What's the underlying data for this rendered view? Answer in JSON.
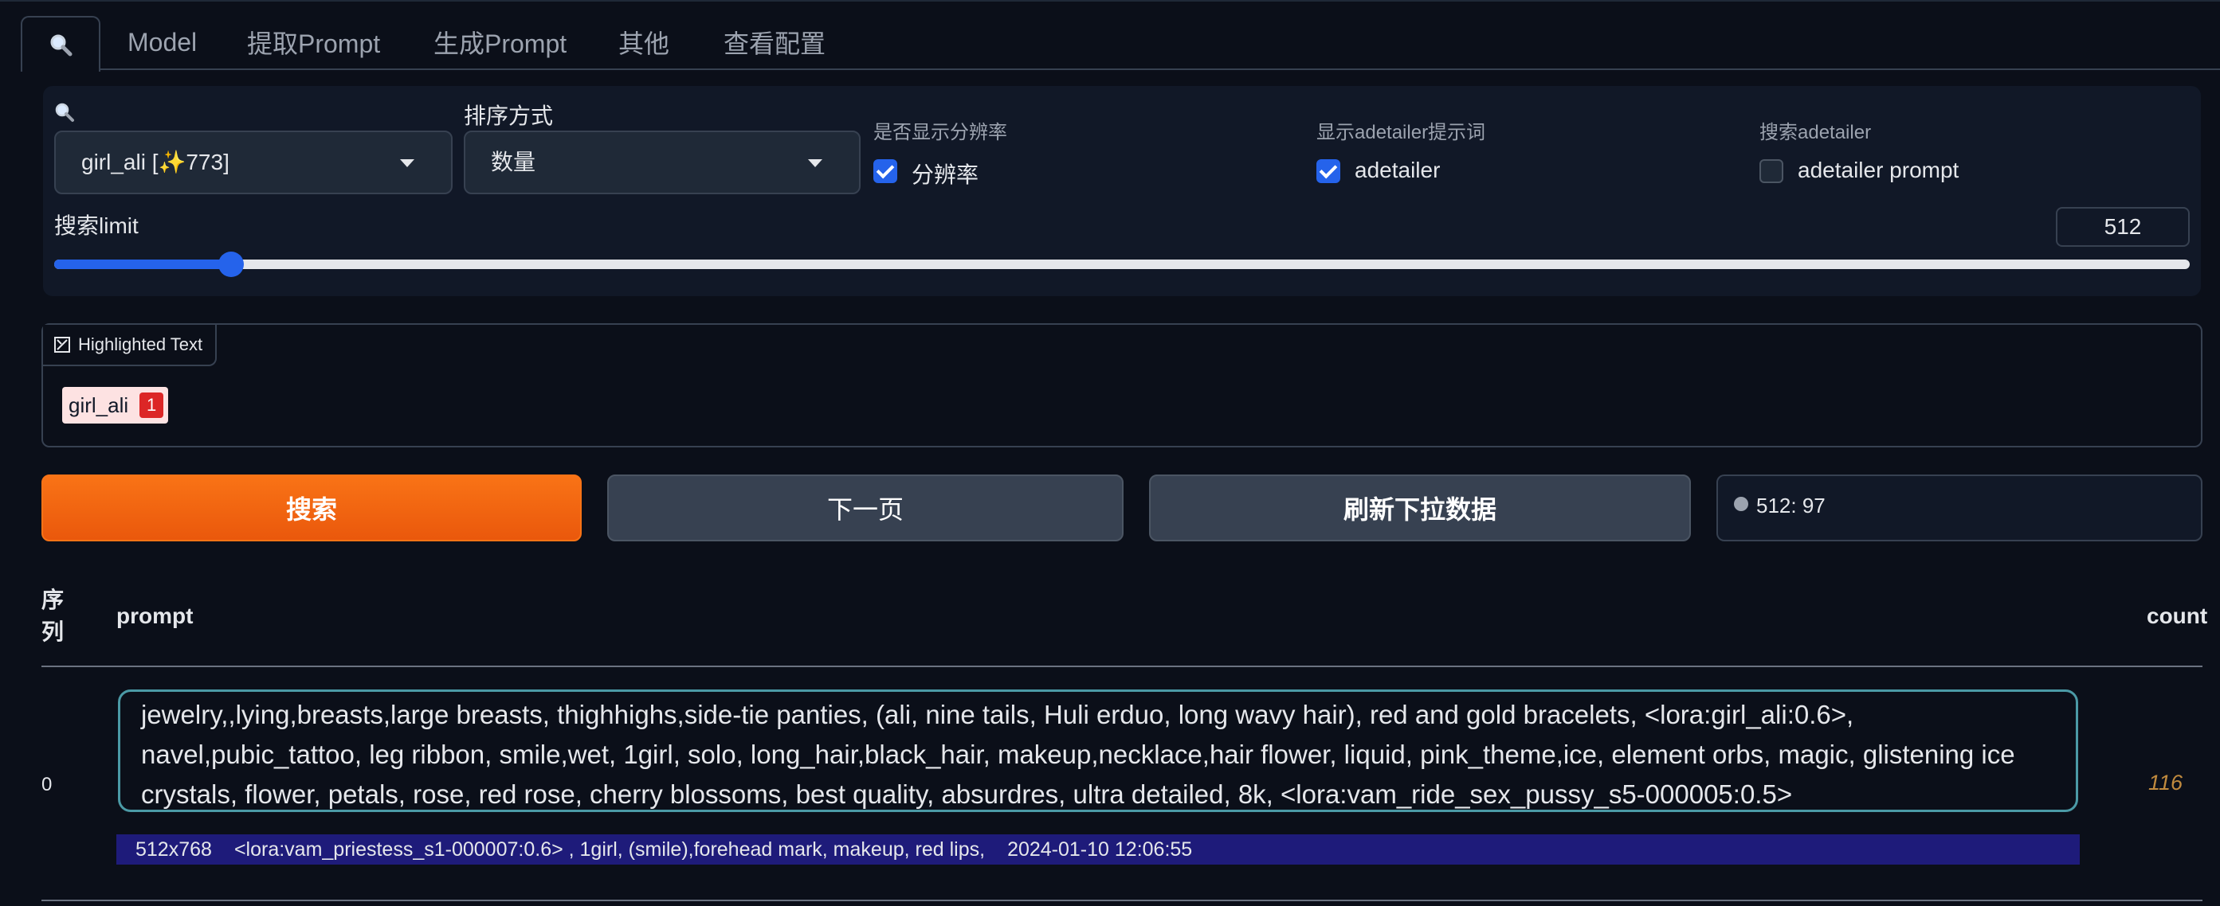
{
  "tabs": [
    {
      "label": ""
    },
    {
      "label": "Model"
    },
    {
      "label": "提取Prompt"
    },
    {
      "label": "生成Prompt"
    },
    {
      "label": "其他"
    },
    {
      "label": "查看配置"
    }
  ],
  "controls": {
    "search_select_value": "girl_ali [✨773]",
    "sort_label": "排序方式",
    "sort_value": "数量",
    "resolution": {
      "group_label": "是否显示分辨率",
      "label": "分辨率",
      "checked": true
    },
    "adetailer_show": {
      "group_label": "显示adetailer提示词",
      "label": "adetailer",
      "checked": true
    },
    "adetailer_search": {
      "group_label": "搜索adetailer",
      "label": "adetailer prompt",
      "checked": false
    },
    "limit_label": "搜索limit",
    "limit_value": "512",
    "slider_fraction": 0.083
  },
  "highlighted": {
    "label": "Highlighted Text",
    "chips": [
      {
        "text": "girl_ali",
        "count": "1"
      }
    ]
  },
  "buttons": {
    "search": "搜索",
    "next_page": "下一页",
    "refresh": "刷新下拉数据"
  },
  "status_text": "512: 97",
  "table": {
    "headers": {
      "index": "序\n列",
      "prompt": "prompt",
      "count": "count"
    },
    "rows": [
      {
        "index": "0",
        "prompt": "jewelry,,lying,breasts,large breasts, thighhighs,side-tie panties, (ali, nine tails, Huli erduo, long wavy hair), red and gold bracelets, <lora:girl_ali:0.6>, navel,pubic_tattoo, leg ribbon, smile,wet, 1girl, solo, long_hair,black_hair, makeup,necklace,hair flower, liquid, pink_theme,ice, element orbs, magic, glistening ice crystals, flower, petals, rose, red rose, cherry blossoms, best quality, absurdres, ultra detailed, 8k, <lora:vam_ride_sex_pussy_s5-000005:0.5>",
        "count": "116",
        "meta": {
          "resolution": "512x768",
          "adetailer": "<lora:vam_priestess_s1-000007:0.6> , 1girl, (smile),forehead mark, makeup, red lips,",
          "date": "2024-01-10 12:06:55"
        }
      }
    ]
  },
  "colors": {
    "accent": "#2563eb",
    "primary_button": "#ea580c",
    "count": "#c08a3e",
    "meta_bg": "#1e1b7a"
  }
}
